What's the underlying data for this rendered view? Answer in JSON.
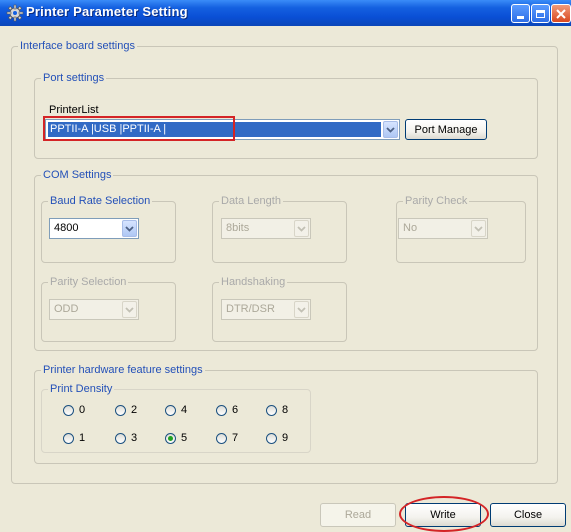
{
  "window": {
    "title": "Printer Parameter Setting"
  },
  "interface_board": {
    "legend": "Interface board settings"
  },
  "port_settings": {
    "legend": "Port settings",
    "printer_list_label": "PrinterList",
    "printer_list_value": "PPTII-A  |USB   |PPTII-A          |",
    "port_manage_button": "Port Manage"
  },
  "com_settings": {
    "legend": "COM Settings",
    "baud_rate": {
      "legend": "Baud Rate Selection",
      "value": "4800"
    },
    "data_length": {
      "legend": "Data Length",
      "value": "8bits"
    },
    "parity_check": {
      "legend": "Parity Check",
      "value": "No"
    },
    "parity_selection": {
      "legend": "Parity Selection",
      "value": "ODD"
    },
    "handshaking": {
      "legend": "Handshaking",
      "value": "DTR/DSR"
    }
  },
  "hardware": {
    "legend": "Printer hardware feature settings",
    "print_density": {
      "legend": "Print Density",
      "options": [
        "0",
        "1",
        "2",
        "3",
        "4",
        "5",
        "6",
        "7",
        "8",
        "9"
      ],
      "selected": "5"
    }
  },
  "buttons": {
    "read": "Read",
    "write": "Write",
    "close": "Close"
  },
  "colors": {
    "titlebar": "#0A4FD6",
    "window_bg": "#ECE9D8",
    "selection": "#316AC5",
    "annotation": "#D42426",
    "legend_text": "#2350B8"
  }
}
